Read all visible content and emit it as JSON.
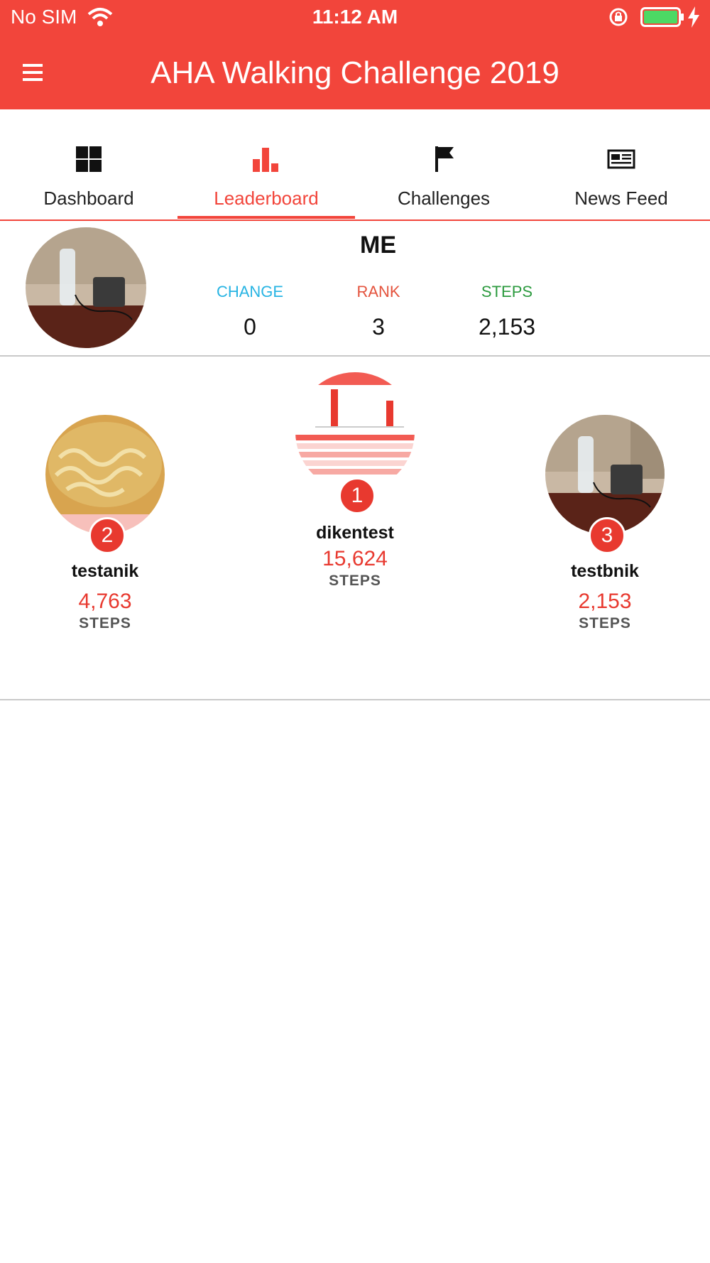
{
  "status_bar": {
    "carrier": "No SIM",
    "time": "11:12 AM"
  },
  "header": {
    "title": "AHA Walking Challenge 2019",
    "accent_color": "#f2453b"
  },
  "tabs": [
    {
      "label": "Dashboard",
      "icon": "grid-icon",
      "active": false
    },
    {
      "label": "Leaderboard",
      "icon": "bar-chart-icon",
      "active": true
    },
    {
      "label": "Challenges",
      "icon": "flag-icon",
      "active": false
    },
    {
      "label": "News Feed",
      "icon": "newspaper-icon",
      "active": false
    }
  ],
  "me": {
    "title": "ME",
    "stats": [
      {
        "label": "CHANGE",
        "value": "0",
        "color": "#27b4e3"
      },
      {
        "label": "RANK",
        "value": "3",
        "color": "#e4533d"
      },
      {
        "label": "STEPS",
        "value": "2,153",
        "color": "#2b9a3e"
      }
    ]
  },
  "leaderboard": [
    {
      "rank": "1",
      "name": "dikentest",
      "steps": "15,624",
      "steps_label": "STEPS"
    },
    {
      "rank": "2",
      "name": "testanik",
      "steps": "4,763",
      "steps_label": "STEPS"
    },
    {
      "rank": "3",
      "name": "testbnik",
      "steps": "2,153",
      "steps_label": "STEPS"
    }
  ]
}
